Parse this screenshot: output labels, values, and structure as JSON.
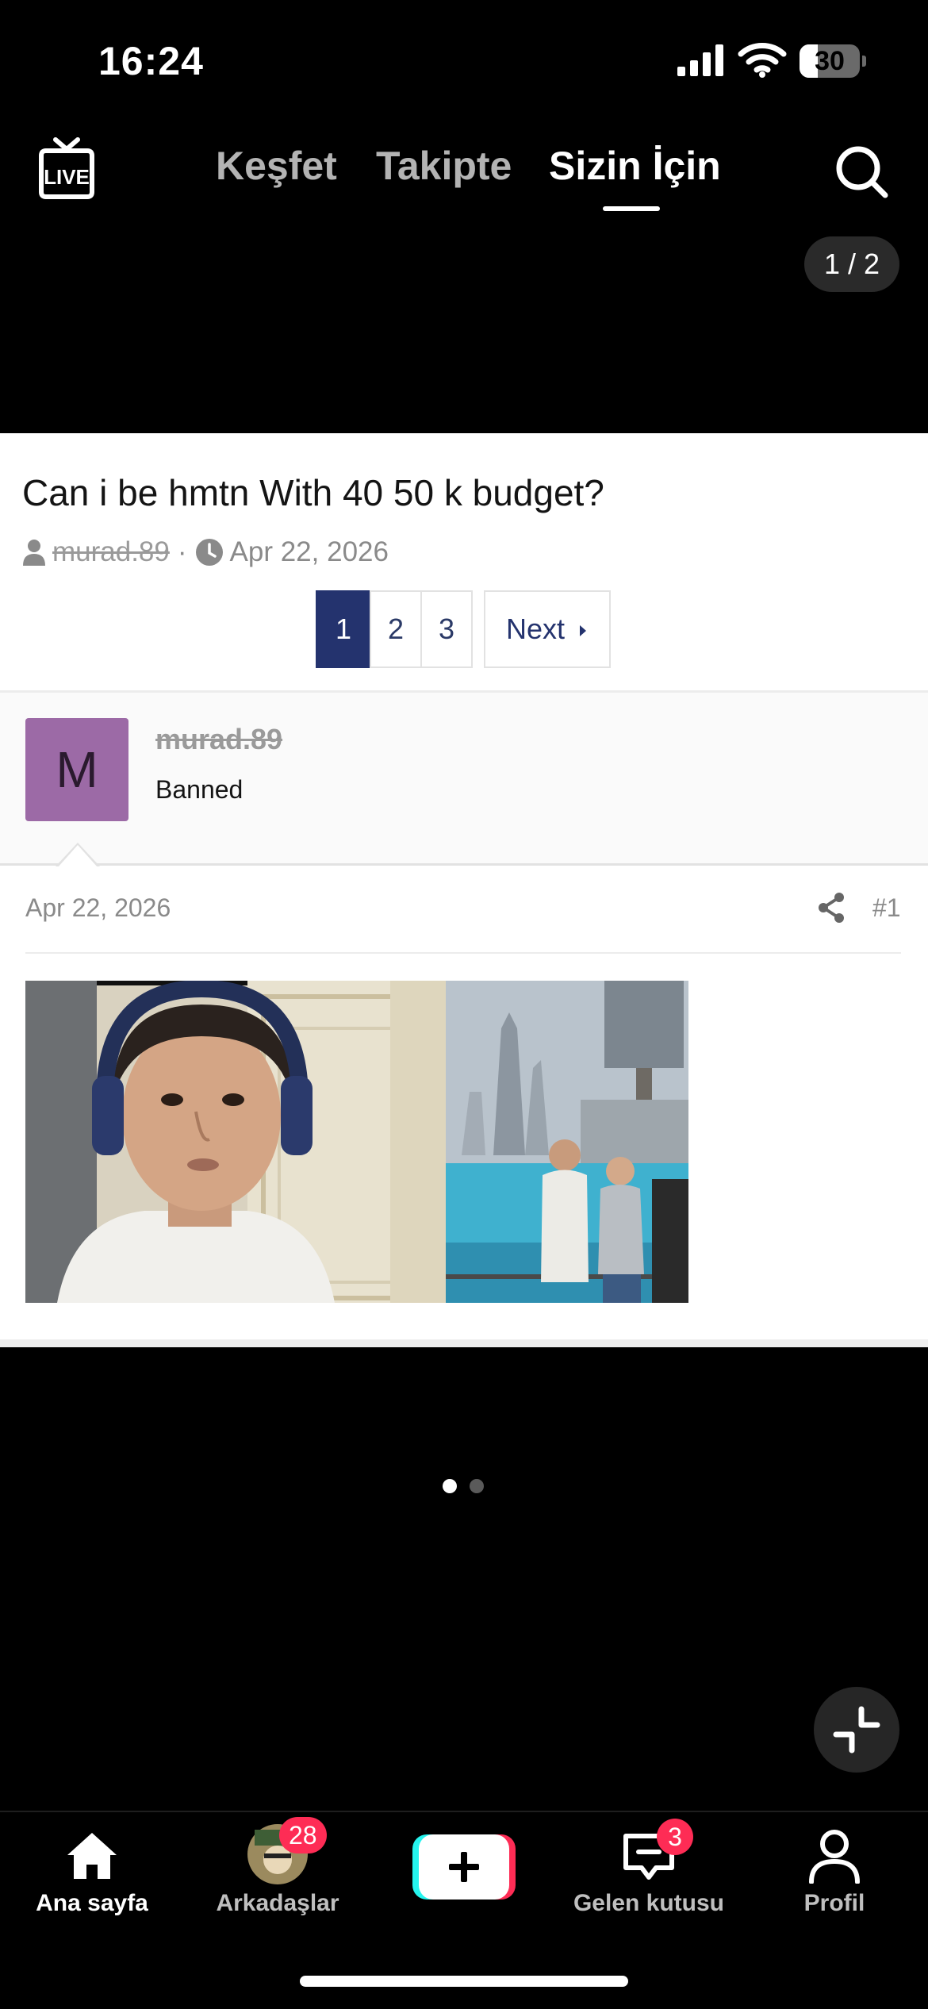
{
  "status_bar": {
    "time": "16:24",
    "battery": "30",
    "battery_level": 0.3
  },
  "top_nav": {
    "tabs": [
      {
        "label": "Keşfet"
      },
      {
        "label": "Takipte"
      },
      {
        "label": "Sizin İçin"
      }
    ],
    "active_tab": "Sizin İçin",
    "live_icon": "live-tv-icon",
    "search_icon": "search-icon"
  },
  "image_counter": "1 / 2",
  "thread": {
    "title": "Can i be hmtn With 40 50 k budget?",
    "author": "murad.89",
    "separator": "·",
    "date": "Apr 22, 2026",
    "pagination": {
      "pages": [
        "1",
        "2",
        "3"
      ],
      "current": "1",
      "next_label": "Next"
    }
  },
  "post": {
    "avatar_letter": "M",
    "avatar_color": "#9c6aa6",
    "username": "murad.89",
    "user_title": "Banned",
    "date": "Apr 22, 2026",
    "post_number": "#1",
    "share_icon": "share-icon"
  },
  "carousel": {
    "total": 2,
    "active": 1
  },
  "tab_bar": {
    "home": "Ana sayfa",
    "friends": "Arkadaşlar",
    "friends_badge": "28",
    "create_icon": "plus-icon",
    "inbox": "Gelen kutusu",
    "inbox_badge": "3",
    "profile": "Profil"
  },
  "colors": {
    "accent_badge": "#fe2c55",
    "pagination_active": "#24336e"
  }
}
